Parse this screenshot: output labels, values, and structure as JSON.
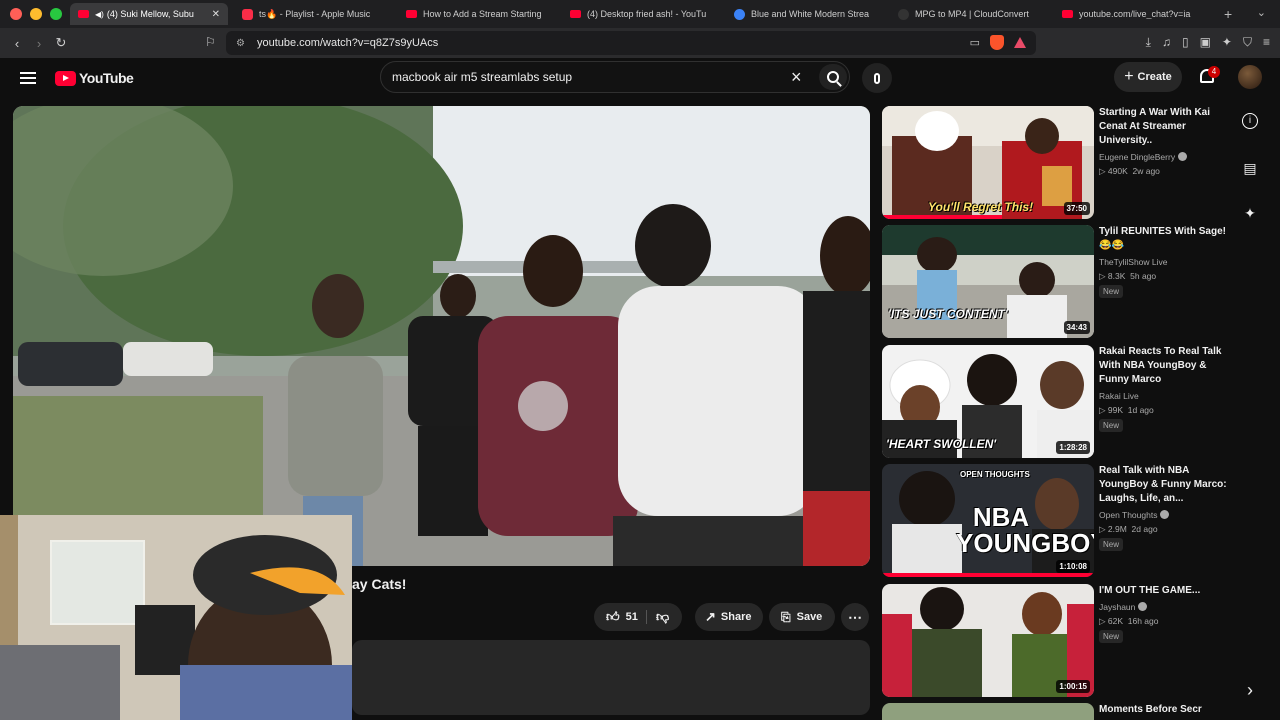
{
  "browser": {
    "tabs": [
      {
        "label": "(4) Suki Mellow, Subu",
        "active": true,
        "icon": "youtube-icon",
        "audio": true
      },
      {
        "label": "ts🔥 - Playlist - Apple Music",
        "active": false,
        "icon": "apple-music-icon"
      },
      {
        "label": "How to Add a Stream Starting",
        "active": false,
        "icon": "youtube-icon"
      },
      {
        "label": "(4) Desktop fried ash! - YouTu",
        "active": false,
        "icon": "youtube-icon"
      },
      {
        "label": "Blue and White Modern Strea",
        "active": false,
        "icon": "canva-icon"
      },
      {
        "label": "MPG to MP4 | CloudConvert",
        "active": false,
        "icon": "cloudconvert-icon"
      },
      {
        "label": "youtube.com/live_chat?v=ia",
        "active": false,
        "icon": "youtube-icon"
      }
    ],
    "url": "youtube.com/watch?v=q8Z7s9yUAcs"
  },
  "youtube": {
    "logo_text": "YouTube",
    "search_value": "macbook air m5 streamlabs setup",
    "create_label": "Create",
    "notif_count": "4"
  },
  "video": {
    "title_visible": "ay Cats!",
    "likes": "51",
    "share_label": "Share",
    "save_label": "Save"
  },
  "recommendations": [
    {
      "title": "Starting A War With Kai Cenat At Streamer University..",
      "channel": "Eugene DingleBerry",
      "verified": true,
      "views": "490K",
      "age": "2w ago",
      "duration": "37:50",
      "new": false,
      "caption": "You'll Regret This!"
    },
    {
      "title": "Tylil REUNITES With Sage! 😂😂",
      "channel": "TheTylilShow Live",
      "verified": false,
      "views": "8.3K",
      "age": "5h ago",
      "duration": "34:43",
      "new": true,
      "caption": "'ITS JUST CONTENT'"
    },
    {
      "title": "Rakai Reacts To Real Talk With NBA YoungBoy & Funny Marco",
      "channel": "Rakai Live",
      "verified": false,
      "views": "99K",
      "age": "1d ago",
      "duration": "1:28:28",
      "new": true,
      "caption": "'HEART SWOLLEN'"
    },
    {
      "title": "Real Talk with NBA YoungBoy & Funny Marco: Laughs, Life, an...",
      "channel": "Open Thoughts",
      "verified": true,
      "views": "2.9M",
      "age": "2d ago",
      "duration": "1:10:08",
      "new": true,
      "caption": "NBA YOUNGBOY"
    },
    {
      "title": "I'M OUT THE GAME...",
      "channel": "Jayshaun",
      "verified": true,
      "views": "62K",
      "age": "16h ago",
      "duration": "1:00:15",
      "new": true,
      "caption": ""
    },
    {
      "title": "Moments Before Secret",
      "channel": "",
      "verified": false,
      "views": "",
      "age": "",
      "duration": "",
      "new": false,
      "caption": ""
    }
  ],
  "labels": {
    "new_badge": "New"
  }
}
